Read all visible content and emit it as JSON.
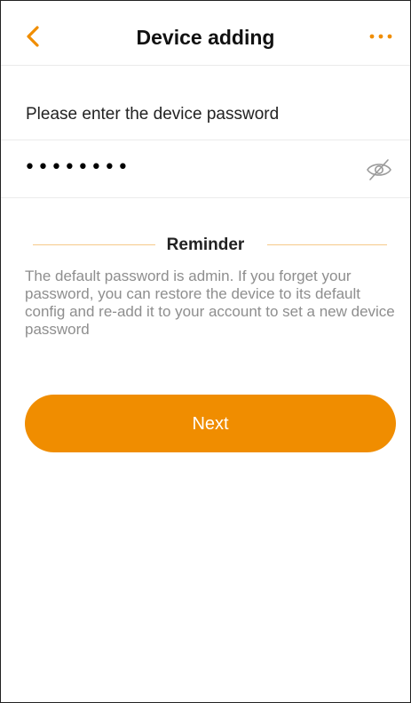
{
  "header": {
    "title": "Device adding",
    "back_icon": "chevron-left-icon",
    "more_icon": "more-dots-icon"
  },
  "form": {
    "prompt": "Please enter the device password",
    "password_value": "admin123",
    "eye_icon": "eye-off-icon"
  },
  "reminder": {
    "title": "Reminder",
    "text": "The default password is admin. If you forget your password, you can restore the device to its default config and re-add it to your account to set a new device password"
  },
  "actions": {
    "next_label": "Next"
  },
  "colors": {
    "accent": "#f08d00",
    "divider": "#ebebeb",
    "reminder_line": "#f6c98a",
    "muted_text": "#8e8e8e"
  }
}
